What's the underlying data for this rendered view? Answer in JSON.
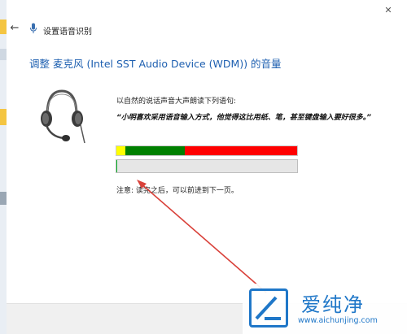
{
  "window": {
    "title": "设置语音识别",
    "back_icon": "back-arrow-icon",
    "close_icon": "close-icon"
  },
  "page": {
    "heading": "调整 麦克风 (Intel SST Audio Device (WDM)) 的音量",
    "prompt": "以自然的说话声音大声朗读下列语句:",
    "sentence": "“小明喜欢采用语音输入方式，他觉得这比用纸、笔，甚至键盘输入要好很多。”",
    "note": "注意: 读完之后，可以前进到下一页。"
  },
  "volume_meter": {
    "segments": [
      {
        "level": "low",
        "color": "#ffff00",
        "fraction": 0.05
      },
      {
        "level": "good",
        "color": "#008000",
        "fraction": 0.33
      },
      {
        "level": "high",
        "color": "#ff0000",
        "fraction": 0.62
      }
    ]
  },
  "progress": {
    "fraction": 0.005,
    "fill_color": "#06b025"
  },
  "annotation": {
    "arrow_color": "#d9413a"
  },
  "watermark": {
    "brand": "爱纯净",
    "url": "www.aichunjing.com",
    "logo_color": "#1f77c8"
  }
}
